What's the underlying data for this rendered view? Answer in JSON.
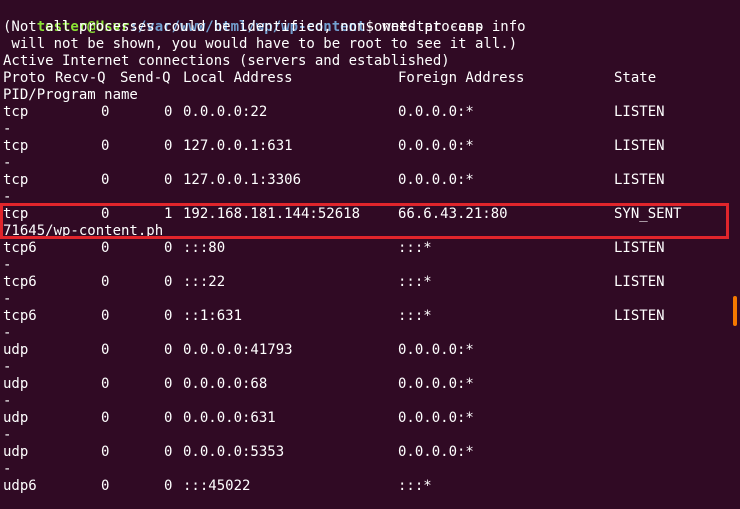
{
  "prompt": {
    "user_host": "tester@Usvr",
    "path": ":/var/www/html/wp/wp-content",
    "symbol": "$",
    "command": " netstat -anp"
  },
  "info_lines": [
    "(Not all processes could be identified, non-owned process info",
    " will not be shown, you would have to be root to see it all.)",
    "Active Internet connections (servers and established)"
  ],
  "headers": {
    "proto": "Proto",
    "recvq": "Recv-Q",
    "sendq": "Send-Q",
    "local": "Local Address",
    "foreign": "Foreign Address",
    "state": "State",
    "pid": "PID/Program name"
  },
  "rows": [
    {
      "proto": "tcp",
      "recvq": "0",
      "sendq": "0",
      "local": "0.0.0.0:22",
      "foreign": "0.0.0.0:*",
      "state": "LISTEN",
      "pid": "-"
    },
    {
      "proto": "tcp",
      "recvq": "0",
      "sendq": "0",
      "local": "127.0.0.1:631",
      "foreign": "0.0.0.0:*",
      "state": "LISTEN",
      "pid": "-"
    },
    {
      "proto": "tcp",
      "recvq": "0",
      "sendq": "0",
      "local": "127.0.0.1:3306",
      "foreign": "0.0.0.0:*",
      "state": "LISTEN",
      "pid": "-"
    },
    {
      "proto": "tcp",
      "recvq": "0",
      "sendq": "1",
      "local": "192.168.181.144:52618",
      "foreign": "66.6.43.21:80",
      "state": "SYN_SENT",
      "pid": "71645/wp-content.ph"
    },
    {
      "proto": "tcp6",
      "recvq": "0",
      "sendq": "0",
      "local": ":::80",
      "foreign": ":::*",
      "state": "LISTEN",
      "pid": "-"
    },
    {
      "proto": "tcp6",
      "recvq": "0",
      "sendq": "0",
      "local": ":::22",
      "foreign": ":::*",
      "state": "LISTEN",
      "pid": "-"
    },
    {
      "proto": "tcp6",
      "recvq": "0",
      "sendq": "0",
      "local": "::1:631",
      "foreign": ":::*",
      "state": "LISTEN",
      "pid": "-"
    },
    {
      "proto": "udp",
      "recvq": "0",
      "sendq": "0",
      "local": "0.0.0.0:41793",
      "foreign": "0.0.0.0:*",
      "state": "",
      "pid": "-"
    },
    {
      "proto": "udp",
      "recvq": "0",
      "sendq": "0",
      "local": "0.0.0.0:68",
      "foreign": "0.0.0.0:*",
      "state": "",
      "pid": "-"
    },
    {
      "proto": "udp",
      "recvq": "0",
      "sendq": "0",
      "local": "0.0.0.0:631",
      "foreign": "0.0.0.0:*",
      "state": "",
      "pid": "-"
    },
    {
      "proto": "udp",
      "recvq": "0",
      "sendq": "0",
      "local": "0.0.0.0:5353",
      "foreign": "0.0.0.0:*",
      "state": "",
      "pid": "-"
    },
    {
      "proto": "udp6",
      "recvq": "0",
      "sendq": "0",
      "local": ":::45022",
      "foreign": ":::*",
      "state": "",
      "pid": ""
    }
  ],
  "colors": {
    "background": "#300a24",
    "text": "#ffffff",
    "prompt_user": "#8ae234",
    "prompt_path": "#729fcf",
    "highlight_border": "#e0252b",
    "scroll_indicator": "#f57900"
  }
}
